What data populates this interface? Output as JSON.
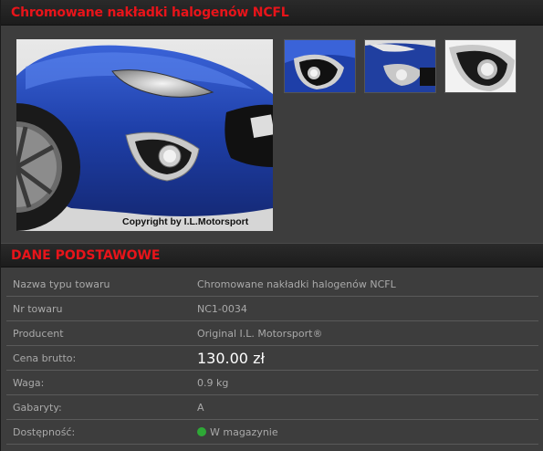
{
  "product": {
    "title": "Chromowane nakładki halogenów NCFL"
  },
  "gallery": {
    "main_caption": "Copyright by I.L.Motorsport",
    "thumbnails": [
      "thumb-1",
      "thumb-2",
      "thumb-3"
    ]
  },
  "section": {
    "title": "DANE PODSTAWOWE"
  },
  "details": {
    "rows": [
      {
        "label": "Nazwa typu towaru",
        "value": "Chromowane nakładki halogenów NCFL"
      },
      {
        "label": "Nr towaru",
        "value": "NC1-0034"
      },
      {
        "label": "Producent",
        "value": "Original I.L. Motorsport®"
      },
      {
        "label": "Cena brutto:",
        "value": "130.00 zł"
      },
      {
        "label": "Waga:",
        "value": "0.9 kg"
      },
      {
        "label": "Gabaryty:",
        "value": "A"
      },
      {
        "label": "Dostępność:",
        "value": "W magazynie"
      }
    ]
  },
  "colors": {
    "title_red": "#e8141a",
    "availability_green": "#2ea836",
    "car_blue": "#1e3fa8"
  }
}
